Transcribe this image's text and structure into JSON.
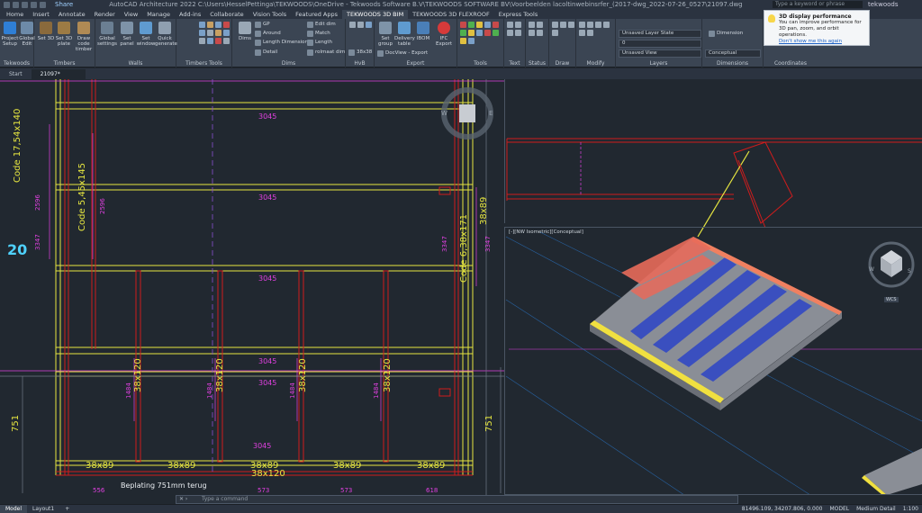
{
  "titlebar": {
    "share": "Share",
    "title": "AutoCAD Architecture 2022    C:\\Users\\HesselPettinga\\TEKWOODS\\OneDrive - Tekwoods Software B.V\\TEKWOODS SOFTWARE BV\\Voorbeelden lacoltinwebinsrfer_(2017-dwg_2022-07-26_0527\\21097.dwg",
    "search_placeholder": "Type a keyword or phrase",
    "user": "tekwoods"
  },
  "ribbon_tabs": [
    "Home",
    "Insert",
    "Annotate",
    "Render",
    "View",
    "Manage",
    "Add-ins",
    "Collaborate",
    "Vision Tools",
    "Featured Apps",
    "TEKWOODS 3D BIM",
    "TEKWOODS 3D FLEXROOF",
    "Express Tools"
  ],
  "ribbon_active_tab": "TEKWOODS 3D BIM",
  "ribbon": {
    "tekwoods": {
      "label": "Tekwoods",
      "project_setup": "Project Setup",
      "global_edit": "Global Edit"
    },
    "timbers": {
      "label": "Timbers",
      "set_3d": "Set 3D",
      "set_3d_plate": "Set 3D plate",
      "draw_code_timber": "Draw code timber"
    },
    "walls": {
      "label": "Walls",
      "global_settings": "Global settings",
      "set_panel": "Set panel",
      "set_window": "Set window",
      "quick_generate": "Quick generate"
    },
    "timber_tools": {
      "label": "Timbers Tools"
    },
    "dims": {
      "label": "Dims",
      "dims": "Dims",
      "gp": "GP",
      "around": "Around",
      "length_dimension": "Length Dimension",
      "detail": "Detail",
      "edit_dim": "Edit dim",
      "match": "Match",
      "length": "Length",
      "rolmaat_dim": "rolmaat dim"
    },
    "hvb": {
      "label": "HvB",
      "size": "38x38"
    },
    "export": {
      "label": "Export",
      "set_group": "Set group",
      "delivery_table": "Delivery table",
      "ibom": "IBOM",
      "ifc_export": "IFC Export",
      "docview": "DocView - Export"
    },
    "tools": {
      "label": "Tools"
    },
    "text": {
      "label": "Text"
    },
    "status": {
      "label": "Status"
    },
    "draw": {
      "label": "Draw"
    },
    "modify": {
      "label": "Modify"
    },
    "layers": {
      "label": "Layers",
      "layer_state": "Unsaved Layer State",
      "layer_value": "0",
      "view": "Unsaved View"
    },
    "dimensions": {
      "label": "Dimensions",
      "dimension": "Dimension",
      "visual_style": "Conceptual"
    },
    "coordinates": {
      "label": "Coordinates"
    }
  },
  "notification": {
    "title": "3D display performance",
    "body": "You can improve performance for 3D pan, zoom, and orbit operations.",
    "link": "Don't show me this again"
  },
  "doc_tabs": [
    "Start",
    "21097*"
  ],
  "drawing": {
    "dim_3045": "3045",
    "code_17": "Code 17,54x140",
    "code_5": "Code 5,45x145",
    "code_6": "Code 6,38x171",
    "dim_2596": "2596",
    "dim_3347": "3347",
    "big_20": "20",
    "dim_38x89": "38x89",
    "dim_38x120": "38x120",
    "dim_1484": "1484",
    "dim_751": "751",
    "beplating": "Beplating 751mm terug",
    "dim_556": "556",
    "dim_573": "573",
    "dim_618": "618",
    "compass_w": "W",
    "compass_e": "E",
    "viewcube_w": "W",
    "viewcube_s": "S",
    "wcs": "WCS"
  },
  "viewport_label": "[-][NW Isometric][Conceptual]",
  "command": {
    "placeholder": "Type a command"
  },
  "layout_tabs": [
    "Model",
    "Layout1"
  ],
  "status": {
    "coords": "81496.109, 34207.806, 0.000",
    "model": "MODEL",
    "detail": "Medium Detail",
    "scale": "1:100"
  },
  "colors": {
    "yellow": "#e6e640",
    "magenta": "#e040e0",
    "red": "#d01c1c",
    "cyan": "#4fd2ff",
    "panel_bg": "#212830"
  }
}
